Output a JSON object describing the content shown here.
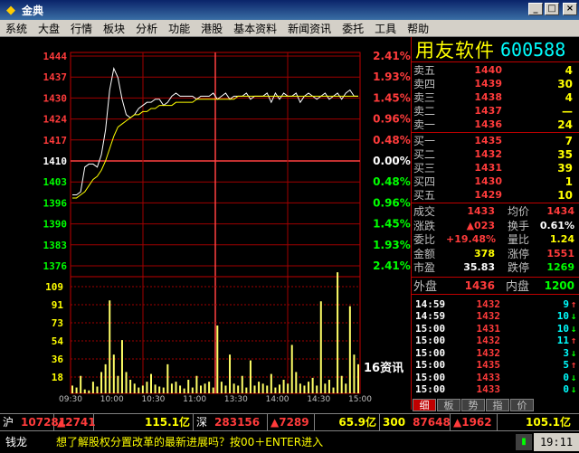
{
  "window": {
    "title": "金典",
    "btn_min": "_",
    "btn_max": "□",
    "btn_close": "×"
  },
  "menu": [
    "系统",
    "大盘",
    "行情",
    "板块",
    "分析",
    "功能",
    "港股",
    "基本资料",
    "新闻资讯",
    "委托",
    "工具",
    "帮助"
  ],
  "stock": {
    "name": "用友软件",
    "code": "600588"
  },
  "chart_data": {
    "type": "line",
    "price_axis": {
      "left": [
        "1444",
        "1437",
        "1430",
        "1424",
        "1417",
        "1410",
        "1403",
        "1396",
        "1390",
        "1383",
        "1376"
      ],
      "right": [
        "2.41%",
        "1.93%",
        "1.45%",
        "0.96%",
        "0.48%",
        "0.00%",
        "0.48%",
        "0.96%",
        "1.45%",
        "1.93%",
        "2.41%"
      ],
      "ylim": [
        1376,
        1444
      ],
      "prev_close": 1410
    },
    "volume_axis": {
      "labels": [
        "109",
        "91",
        "73",
        "54",
        "36",
        "18"
      ],
      "ylim": [
        0,
        127
      ]
    },
    "time_axis": [
      "09:30",
      "10:00",
      "10:30",
      "11:00",
      "13:30",
      "14:00",
      "14:30",
      "15:00"
    ],
    "price_series": [
      1399,
      1399,
      1400,
      1408,
      1409,
      1409,
      1408,
      1412,
      1420,
      1433,
      1440,
      1437,
      1430,
      1425,
      1424,
      1425,
      1427,
      1428,
      1429,
      1429,
      1430,
      1430,
      1428,
      1429,
      1431,
      1432,
      1431,
      1431,
      1431,
      1431,
      1430,
      1431,
      1431,
      1431,
      1432,
      1430,
      1431,
      1432,
      1430,
      1431,
      1431,
      1431,
      1432,
      1430,
      1431,
      1431,
      1431,
      1432,
      1429,
      1432,
      1430,
      1432,
      1431,
      1431,
      1432,
      1429,
      1431,
      1432,
      1431,
      1430,
      1431,
      1432,
      1430,
      1431,
      1432,
      1430,
      1432,
      1433,
      1431,
      1431
    ],
    "avg_series": [
      1398,
      1398,
      1399,
      1400,
      1402,
      1404,
      1405,
      1407,
      1410,
      1414,
      1418,
      1421,
      1422,
      1423,
      1424,
      1425,
      1425,
      1426,
      1426,
      1427,
      1427,
      1428,
      1428,
      1428,
      1428,
      1429,
      1429,
      1429,
      1429,
      1429,
      1430,
      1430,
      1430,
      1430,
      1430,
      1430,
      1430,
      1430,
      1430,
      1430,
      1431,
      1431,
      1431,
      1431,
      1431,
      1431,
      1431,
      1431,
      1431,
      1431,
      1431,
      1431,
      1431,
      1431,
      1431,
      1431,
      1431,
      1431,
      1431,
      1431,
      1431,
      1431,
      1431,
      1431,
      1431,
      1431,
      1431,
      1431,
      1431,
      1431
    ],
    "volume_series": [
      8,
      6,
      18,
      4,
      3,
      12,
      7,
      22,
      30,
      96,
      40,
      18,
      55,
      22,
      14,
      10,
      6,
      8,
      12,
      20,
      9,
      7,
      6,
      30,
      10,
      12,
      8,
      5,
      14,
      6,
      18,
      8,
      10,
      12,
      6,
      70,
      12,
      8,
      40,
      10,
      8,
      18,
      6,
      34,
      8,
      12,
      10,
      8,
      20,
      6,
      9,
      14,
      10,
      50,
      22,
      10,
      8,
      12,
      16,
      8,
      95,
      10,
      14,
      6,
      125,
      18,
      10,
      90,
      40,
      30
    ],
    "annotation": "16资讯"
  },
  "orderbook": {
    "asks": [
      {
        "label": "卖五",
        "price": "1440",
        "vol": "4"
      },
      {
        "label": "卖四",
        "price": "1439",
        "vol": "30"
      },
      {
        "label": "卖三",
        "price": "1438",
        "vol": "4"
      },
      {
        "label": "卖二",
        "price": "1437",
        "vol": "—"
      },
      {
        "label": "卖一",
        "price": "1436",
        "vol": "24"
      }
    ],
    "bids": [
      {
        "label": "买一",
        "price": "1435",
        "vol": "7"
      },
      {
        "label": "买二",
        "price": "1432",
        "vol": "35"
      },
      {
        "label": "买三",
        "price": "1431",
        "vol": "39"
      },
      {
        "label": "买四",
        "price": "1430",
        "vol": "1"
      },
      {
        "label": "买五",
        "price": "1429",
        "vol": "10"
      }
    ]
  },
  "stats": [
    {
      "l": "成交",
      "v": "1433",
      "l2": "均价",
      "v2": "1434"
    },
    {
      "l": "涨跌",
      "v": "▲023",
      "l2": "换手",
      "v2": "0.61%"
    },
    {
      "l": "委比",
      "v": "+19.48%",
      "l2": "量比",
      "v2": "1.24"
    },
    {
      "l": "金额",
      "v": "378",
      "l2": "涨停",
      "v2": "1551"
    },
    {
      "l": "市盈",
      "v": "35.83",
      "l2": "跌停",
      "v2": "1269"
    }
  ],
  "outin": {
    "l": "外盘",
    "v": "1436",
    "l2": "内盘",
    "v2": "1200"
  },
  "ticks": [
    {
      "t": "14:59",
      "p": "1432",
      "q": "9",
      "d": "up"
    },
    {
      "t": "14:59",
      "p": "1432",
      "q": "10",
      "d": "down"
    },
    {
      "t": "15:00",
      "p": "1431",
      "q": "10",
      "d": "down"
    },
    {
      "t": "15:00",
      "p": "1432",
      "q": "11",
      "d": "up"
    },
    {
      "t": "15:00",
      "p": "1432",
      "q": "3",
      "d": "down"
    },
    {
      "t": "15:00",
      "p": "1435",
      "q": "5",
      "d": "up"
    },
    {
      "t": "15:00",
      "p": "1433",
      "q": "0",
      "d": "down"
    },
    {
      "t": "15:00",
      "p": "1433",
      "q": "0",
      "d": "down"
    }
  ],
  "tabs": [
    "细",
    "板",
    "势",
    "指",
    "价"
  ],
  "indexbar": {
    "sh_name": "沪",
    "sh_val": "107281",
    "sh_chg": "▲2741",
    "sh_amt": "115.1亿",
    "sz_name": "深",
    "sz_val": "283156",
    "sz_chg": "▲7289",
    "sz_amt": "65.9亿",
    "c3_name": "300",
    "c3_val": "87648",
    "c3_chg": "▲1962",
    "c3_amt": "105.1亿"
  },
  "status": {
    "logo": "钱龙",
    "message": "想了解股权分置改革的最新进展吗？按00＋ENTER进入",
    "clock": "19:11"
  }
}
